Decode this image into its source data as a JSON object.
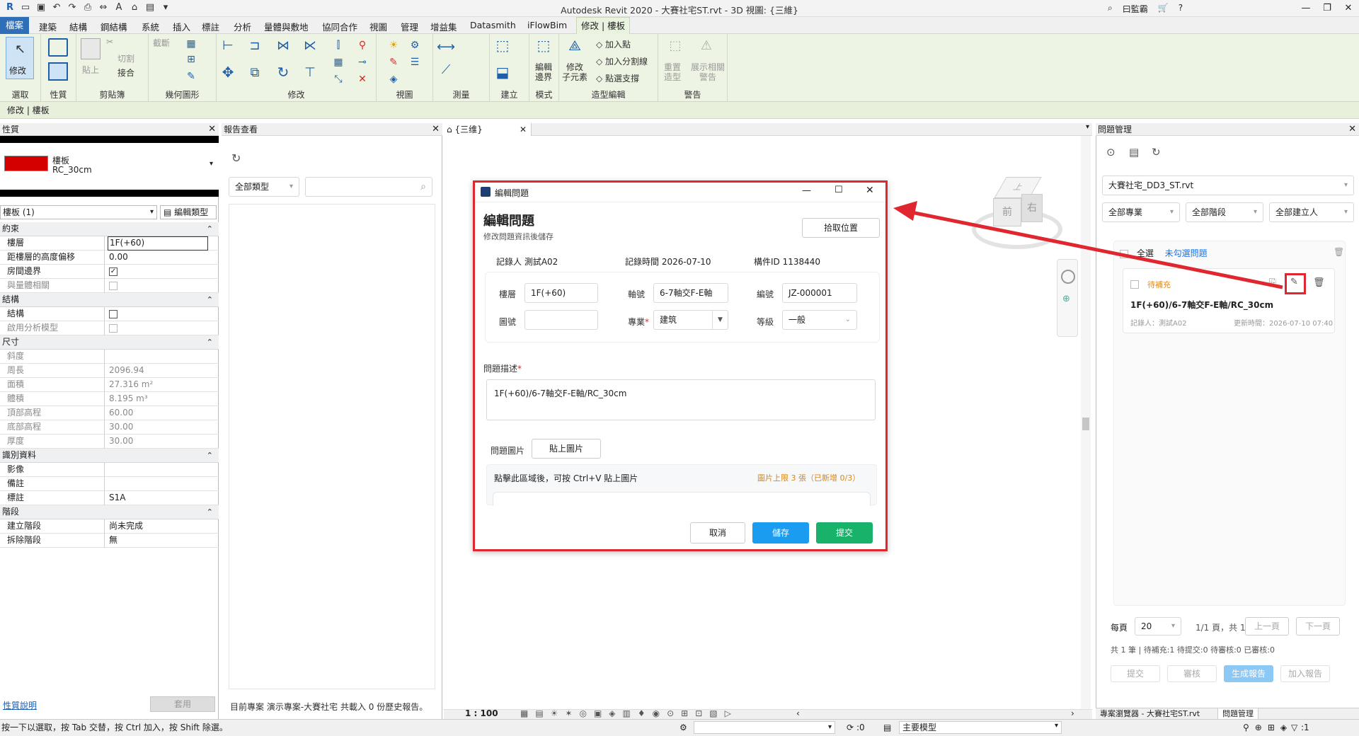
{
  "window": {
    "title": "Autodesk Revit 2020 - 大賽社宅ST.rvt - 3D 視圖: {三維}",
    "user": "曰監霸"
  },
  "tabs": [
    "檔案",
    "建築",
    "結構",
    "鋼結構",
    "系統",
    "插入",
    "標註",
    "分析",
    "量體與敷地",
    "協同合作",
    "視圖",
    "管理",
    "增益集",
    "Datasmith",
    "iFlowBim",
    "修改 | 樓板"
  ],
  "ribbon": {
    "groups": [
      "選取",
      "性質",
      "剪貼簿",
      "幾何圖形",
      "修改",
      "視圖",
      "測量",
      "建立",
      "模式",
      "造型編輯",
      "警告"
    ],
    "modify_label": "修改",
    "paste_label": "貼上",
    "cut_label": "切割",
    "join_label": "接合",
    "clip_label": "截斷",
    "edit_boundary": "編輯\n邊界",
    "modify_sub": "修改\n子元素",
    "add_point": "加入點",
    "add_split": "加入分割線",
    "pick_support": "點選支撐",
    "reset_shape": "重置\n造型",
    "show_warn": "展示相關\n警告"
  },
  "context_bar": "修改 | 樓板",
  "properties": {
    "header": "性質",
    "type_name": "樓板",
    "type_sub": "RC_30cm",
    "selector": "樓板 (1)",
    "edit_type": "編輯類型",
    "sections": [
      {
        "title": "約束",
        "rows": [
          {
            "k": "樓層",
            "v": "1F(+60)",
            "boxed": true
          },
          {
            "k": "距樓層的高度偏移",
            "v": "0.00"
          },
          {
            "k": "房間邊界",
            "check": "on"
          },
          {
            "k": "與量體相關",
            "check": "off",
            "dim": true
          }
        ]
      },
      {
        "title": "結構",
        "rows": [
          {
            "k": "結構",
            "check": "empty"
          },
          {
            "k": "啟用分析模型",
            "check": "off",
            "dim": true
          }
        ]
      },
      {
        "title": "尺寸",
        "rows": [
          {
            "k": "斜度",
            "v": "",
            "dim": true
          },
          {
            "k": "周長",
            "v": "2096.94",
            "dim": true
          },
          {
            "k": "面積",
            "v": "27.316 m²",
            "dim": true
          },
          {
            "k": "體積",
            "v": "8.195 m³",
            "dim": true
          },
          {
            "k": "頂部高程",
            "v": "60.00",
            "dim": true
          },
          {
            "k": "底部高程",
            "v": "30.00",
            "dim": true
          },
          {
            "k": "厚度",
            "v": "30.00",
            "dim": true
          }
        ]
      },
      {
        "title": "識別資料",
        "rows": [
          {
            "k": "影像",
            "v": ""
          },
          {
            "k": "備註",
            "v": ""
          },
          {
            "k": "標註",
            "v": "S1A"
          }
        ]
      },
      {
        "title": "階段",
        "rows": [
          {
            "k": "建立階段",
            "v": "尚未完成"
          },
          {
            "k": "拆除階段",
            "v": "無"
          }
        ]
      }
    ],
    "help_link": "性質說明",
    "apply": "套用"
  },
  "report": {
    "header": "報告查看",
    "filter": "全部類型",
    "footer": "目前專案 演示專案-大賽社宅 共載入 0 份歷史報告。"
  },
  "view": {
    "tab": "{三维}",
    "scale": "1 : 100",
    "cube_top": "上",
    "cube_front": "前",
    "cube_right": "右"
  },
  "dialog": {
    "window_title": "編輯問題",
    "heading": "編輯問題",
    "subheading": "修改問題資訊後儲存",
    "pick_location": "拾取位置",
    "recorder": "記錄人  測試A02",
    "record_time": "記錄時間  2026-07-10",
    "element_id": "構件ID  1138440",
    "floor_label": "樓層",
    "floor": "1F(+60)",
    "axis_label": "軸號",
    "axis": "6-7軸交F-E軸",
    "code_label": "編號",
    "code": "JZ-000001",
    "drawing_label": "圖號",
    "drawing": "",
    "discipline_label": "專業",
    "discipline": "建筑",
    "level_label": "等級",
    "level": "一般",
    "desc_label": "問題描述",
    "desc": "1F(+60)/6-7軸交F-E軸/RC_30cm",
    "image_label": "問題圖片",
    "paste_image": "貼上圖片",
    "paste_hint": "點擊此區域後，可按 Ctrl+V 貼上圖片",
    "image_limit": "圖片上限 3 張（已新增 0/3）",
    "cancel": "取消",
    "save": "儲存",
    "submit": "提交"
  },
  "issues": {
    "header": "問題管理",
    "project": "大賽社宅_DD3_ST.rvt",
    "filter_discipline": "全部專業",
    "filter_stage": "全部階段",
    "filter_creator": "全部建立人",
    "select_all": "全選",
    "unchecked": "未勾選問題",
    "card": {
      "status": "待補充",
      "title": "1F(+60)/6-7軸交F-E軸/RC_30cm",
      "recorder": "記錄人：測試A02",
      "updated": "更新時間：2026-07-10 07:40"
    },
    "per_page_label": "每頁",
    "per_page": "20",
    "page_info": "1/1 頁，共 1",
    "prev": "上一頁",
    "next": "下一頁",
    "summary": "共 1 筆 | 待補充:1 待提交:0 待審核:0 已審核:0",
    "btn_submit": "提交",
    "btn_review": "審核",
    "btn_report": "生成報告",
    "btn_add_report": "加入報告"
  },
  "bottom_tabs": {
    "project_browser": "專案瀏覽器 - 大賽社宅ST.rvt",
    "issues": "問題管理"
  },
  "status": {
    "hint": "按一下以選取，按 Tab 交替，按 Ctrl 加入，按 Shift 除選。",
    "count": ":0",
    "model": "主要模型",
    "filter": ":1"
  },
  "colors": {
    "accent_red": "#e0262e",
    "save_blue": "#1a9cf0",
    "submit_green": "#19b26b",
    "status_orange": "#e08a1e",
    "link_blue": "#1a73e8"
  }
}
